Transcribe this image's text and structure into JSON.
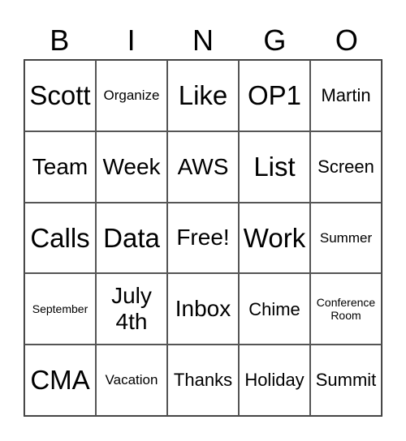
{
  "header": [
    "B",
    "I",
    "N",
    "G",
    "O"
  ],
  "cells": [
    {
      "text": "Scott",
      "size": "xl"
    },
    {
      "text": "Organize",
      "size": "s"
    },
    {
      "text": "Like",
      "size": "xl"
    },
    {
      "text": "OP1",
      "size": "xl"
    },
    {
      "text": "Martin",
      "size": "m"
    },
    {
      "text": "Team",
      "size": "l"
    },
    {
      "text": "Week",
      "size": "l"
    },
    {
      "text": "AWS",
      "size": "l"
    },
    {
      "text": "List",
      "size": "xl"
    },
    {
      "text": "Screen",
      "size": "m"
    },
    {
      "text": "Calls",
      "size": "xl"
    },
    {
      "text": "Data",
      "size": "xl"
    },
    {
      "text": "Free!",
      "size": "l"
    },
    {
      "text": "Work",
      "size": "xl"
    },
    {
      "text": "Summer",
      "size": "s"
    },
    {
      "text": "September",
      "size": "xs"
    },
    {
      "text": "July\n4th",
      "size": "l"
    },
    {
      "text": "Inbox",
      "size": "l"
    },
    {
      "text": "Chime",
      "size": "m"
    },
    {
      "text": "Conference\nRoom",
      "size": "xs"
    },
    {
      "text": "CMA",
      "size": "xl"
    },
    {
      "text": "Vacation",
      "size": "s"
    },
    {
      "text": "Thanks",
      "size": "m"
    },
    {
      "text": "Holiday",
      "size": "m"
    },
    {
      "text": "Summit",
      "size": "m"
    }
  ]
}
